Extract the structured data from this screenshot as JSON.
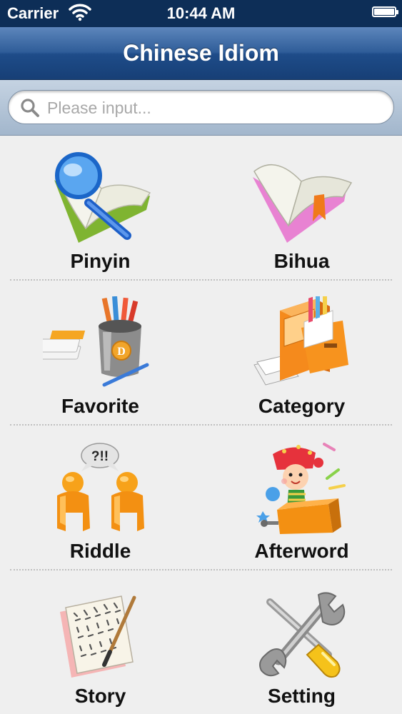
{
  "status_bar": {
    "carrier": "Carrier",
    "time": "10:44 AM",
    "icons": [
      "wifi-icon",
      "battery-icon"
    ]
  },
  "nav": {
    "title": "Chinese Idiom"
  },
  "search": {
    "placeholder": "Please input...",
    "value": "",
    "icon": "search-icon"
  },
  "menu": {
    "pinyin": {
      "label": "Pinyin",
      "icon": "open-book-magnifier-icon"
    },
    "bihua": {
      "label": "Bihua",
      "icon": "open-book-bookmark-icon"
    },
    "favorite": {
      "label": "Favorite",
      "icon": "pencil-cup-icon"
    },
    "category": {
      "label": "Category",
      "icon": "file-cabinet-icon"
    },
    "riddle": {
      "label": "Riddle",
      "icon": "two-people-talking-icon",
      "bubble_text": "?!!"
    },
    "afterword": {
      "label": "Afterword",
      "icon": "jack-in-the-box-icon"
    },
    "story": {
      "label": "Story",
      "icon": "calligraphy-paper-icon"
    },
    "setting": {
      "label": "Setting",
      "icon": "wrench-screwdriver-icon"
    }
  },
  "colors": {
    "nav_dark": "#173f76",
    "nav_light": "#5d86bc",
    "status_bar": "#0d2e57",
    "background": "#efefef",
    "search_bar": "#a2b6cc"
  }
}
